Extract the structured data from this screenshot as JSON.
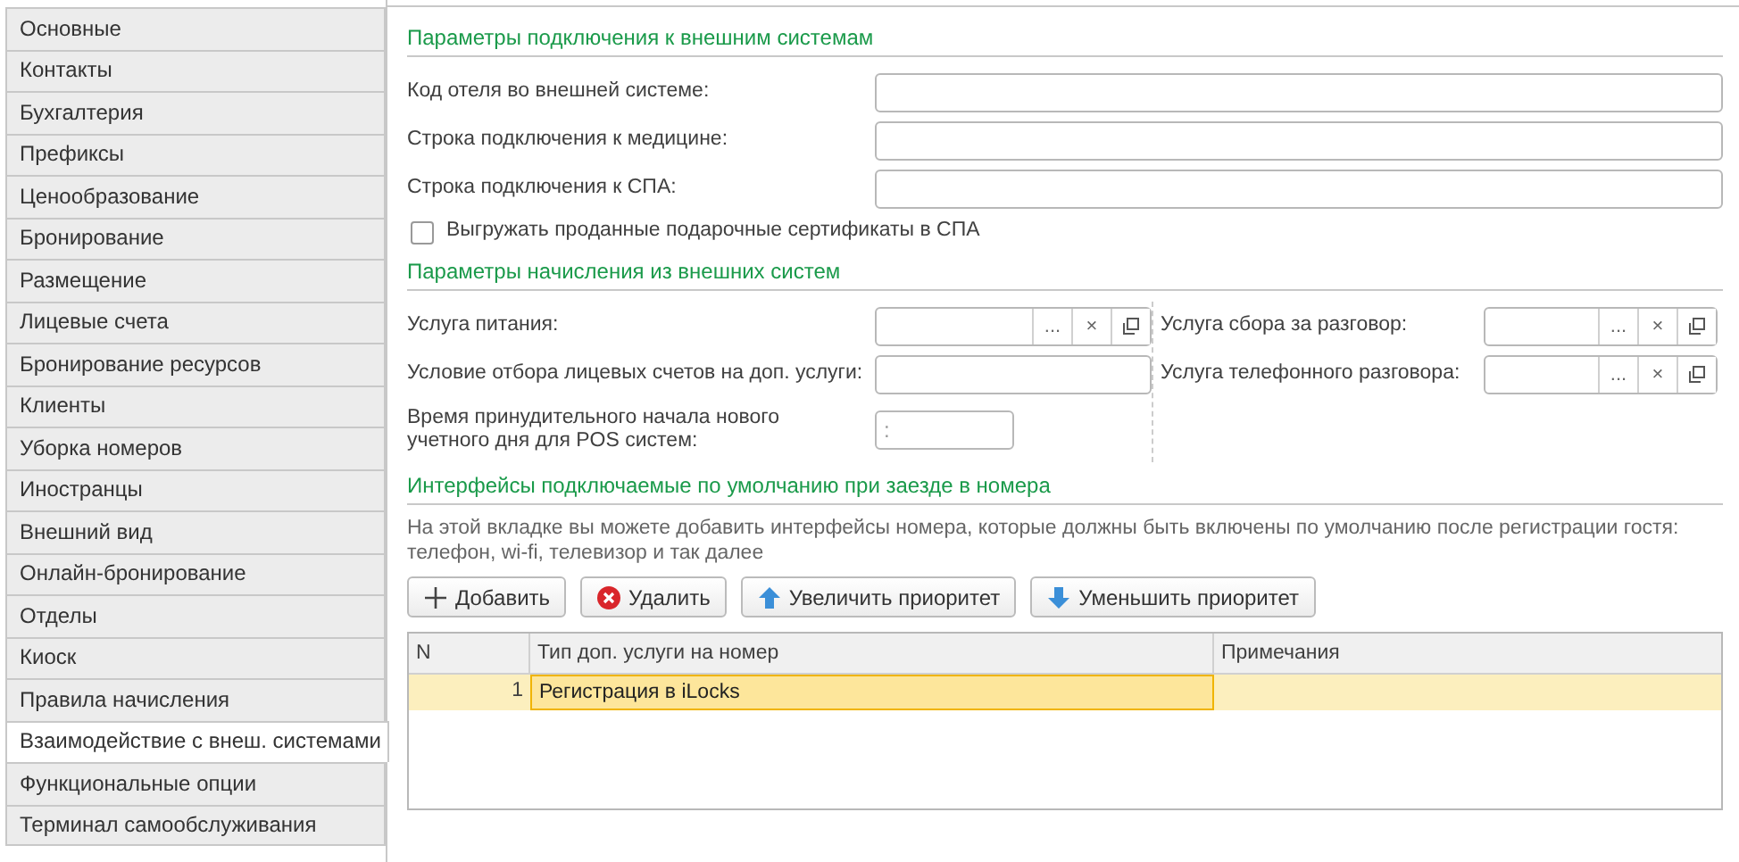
{
  "tabs": [
    {
      "label": "Основные",
      "selected": false
    },
    {
      "label": "Контакты",
      "selected": false
    },
    {
      "label": "Бухгалтерия",
      "selected": false
    },
    {
      "label": "Префиксы",
      "selected": false
    },
    {
      "label": "Ценообразование",
      "selected": false
    },
    {
      "label": "Бронирование",
      "selected": false
    },
    {
      "label": "Размещение",
      "selected": false
    },
    {
      "label": "Лицевые счета",
      "selected": false
    },
    {
      "label": "Бронирование ресурсов",
      "selected": false
    },
    {
      "label": "Клиенты",
      "selected": false
    },
    {
      "label": "Уборка номеров",
      "selected": false
    },
    {
      "label": "Иностранцы",
      "selected": false
    },
    {
      "label": "Внешний вид",
      "selected": false
    },
    {
      "label": "Онлайн-бронирование",
      "selected": false
    },
    {
      "label": "Отделы",
      "selected": false
    },
    {
      "label": "Киоск",
      "selected": false
    },
    {
      "label": "Правила начисления",
      "selected": false
    },
    {
      "label": "Взаимодействие с внеш. системами",
      "selected": true
    },
    {
      "label": "Функциональные опции",
      "selected": false
    },
    {
      "label": "Терминал самообслуживания",
      "selected": false
    }
  ],
  "connection": {
    "title": "Параметры подключения к внешним системам",
    "fields": [
      {
        "label": "Код отеля во внешней системе:"
      },
      {
        "label": "Строка подключения к медицине:"
      },
      {
        "label": "Строка подключения к СПА:"
      }
    ],
    "checkbox": {
      "label": "Выгружать проданные подарочные сертификаты в СПА",
      "checked": false
    }
  },
  "accrual": {
    "title": "Параметры начисления из внешних систем",
    "left": [
      {
        "label": "Услуга питания:",
        "kind": "select",
        "select_button": "...",
        "clear_button": "×"
      },
      {
        "label": "Условие отбора лицевых счетов на доп. услуги:",
        "kind": "text"
      },
      {
        "label": "Время принудительного начала нового учетного дня для POS систем:",
        "kind": "time",
        "value": ":"
      }
    ],
    "right": [
      {
        "label": "Услуга сбора за разговор:",
        "kind": "select",
        "select_button": "...",
        "clear_button": "×"
      },
      {
        "label": "Услуга телефонного разговора:",
        "kind": "select",
        "select_button": "...",
        "clear_button": "×"
      }
    ]
  },
  "interfaces": {
    "title": "Интерфейсы подключаемые по умолчанию при заезде в номера",
    "hint": "На этой вкладке вы можете добавить интерфейсы номера, которые должны быть включены по умолчанию после регистрации гостя: телефон, wi-fi, телевизор и так далее",
    "buttons": [
      {
        "label": "Добавить",
        "kind": "add"
      },
      {
        "label": "Удалить",
        "kind": "delete"
      },
      {
        "label": "Увеличить приоритет",
        "kind": "up"
      },
      {
        "label": "Уменьшить приоритет",
        "kind": "down"
      }
    ],
    "table": {
      "columns": [
        "N",
        "Тип доп. услуги на номер",
        "Примечания"
      ],
      "rows": [
        {
          "n": "1",
          "type": "Регистрация в iLocks",
          "selected": true
        }
      ]
    }
  }
}
